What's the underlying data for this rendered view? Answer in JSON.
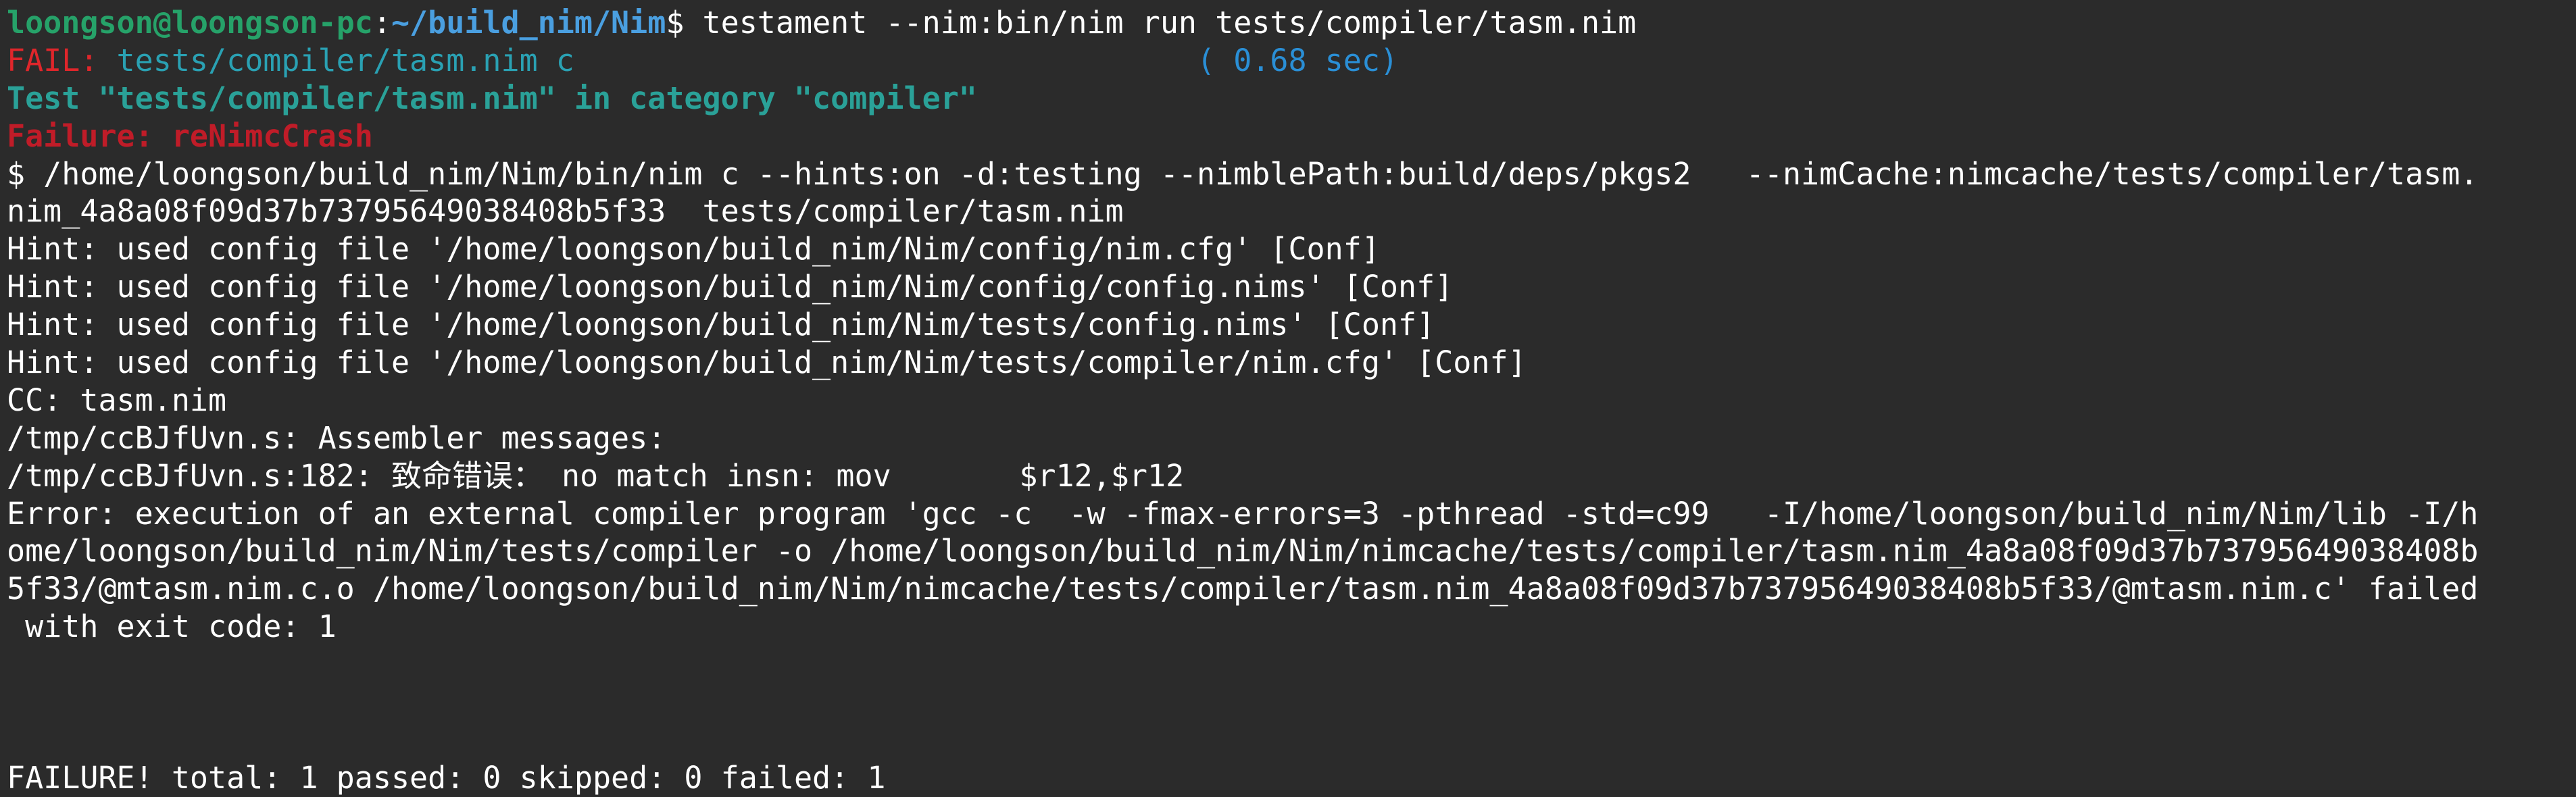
{
  "prompt": {
    "user_host": "loongson@loongson-pc",
    "sep": ":",
    "cwd": "~/build_nim/Nim",
    "symbol": "$",
    "command": " testament --nim:bin/nim run tests/compiler/tasm.nim"
  },
  "result": {
    "status": "FAIL:",
    "target": " tests/compiler/tasm.nim c",
    "gap": "                                  ",
    "time": "( 0.68 sec)"
  },
  "test_line": "Test \"tests/compiler/tasm.nim\" in category \"compiler\"",
  "failure_line": "Failure: reNimcCrash",
  "output_lines": [
    "$ /home/loongson/build_nim/Nim/bin/nim c --hints:on -d:testing --nimblePath:build/deps/pkgs2   --nimCache:nimcache/tests/compiler/tasm.",
    "nim_4a8a08f09d37b73795649038408b5f33  tests/compiler/tasm.nim",
    "Hint: used config file '/home/loongson/build_nim/Nim/config/nim.cfg' [Conf]",
    "Hint: used config file '/home/loongson/build_nim/Nim/config/config.nims' [Conf]",
    "Hint: used config file '/home/loongson/build_nim/Nim/tests/config.nims' [Conf]",
    "Hint: used config file '/home/loongson/build_nim/Nim/tests/compiler/nim.cfg' [Conf]",
    "CC: tasm.nim",
    "/tmp/ccBJfUvn.s: Assembler messages:",
    "/tmp/ccBJfUvn.s:182: 致命错误： no match insn: mov       $r12,$r12",
    "Error: execution of an external compiler program 'gcc -c  -w -fmax-errors=3 -pthread -std=c99   -I/home/loongson/build_nim/Nim/lib -I/h",
    "ome/loongson/build_nim/Nim/tests/compiler -o /home/loongson/build_nim/Nim/nimcache/tests/compiler/tasm.nim_4a8a08f09d37b73795649038408b",
    "5f33/@mtasm.nim.c.o /home/loongson/build_nim/Nim/nimcache/tests/compiler/tasm.nim_4a8a08f09d37b73795649038408b5f33/@mtasm.nim.c' failed",
    " with exit code: 1"
  ],
  "summary": "FAILURE! total: 1 passed: 0 skipped: 0 failed: 1",
  "colors": {
    "background": "#2b2b2b",
    "text": "#ffffff",
    "prompt_user": "#26a269",
    "prompt_path": "#4a9fe0",
    "fail": "#e0262b",
    "teal": "#2aa1b3",
    "time": "#2a8fd6",
    "failure_reason": "#c01c28"
  }
}
